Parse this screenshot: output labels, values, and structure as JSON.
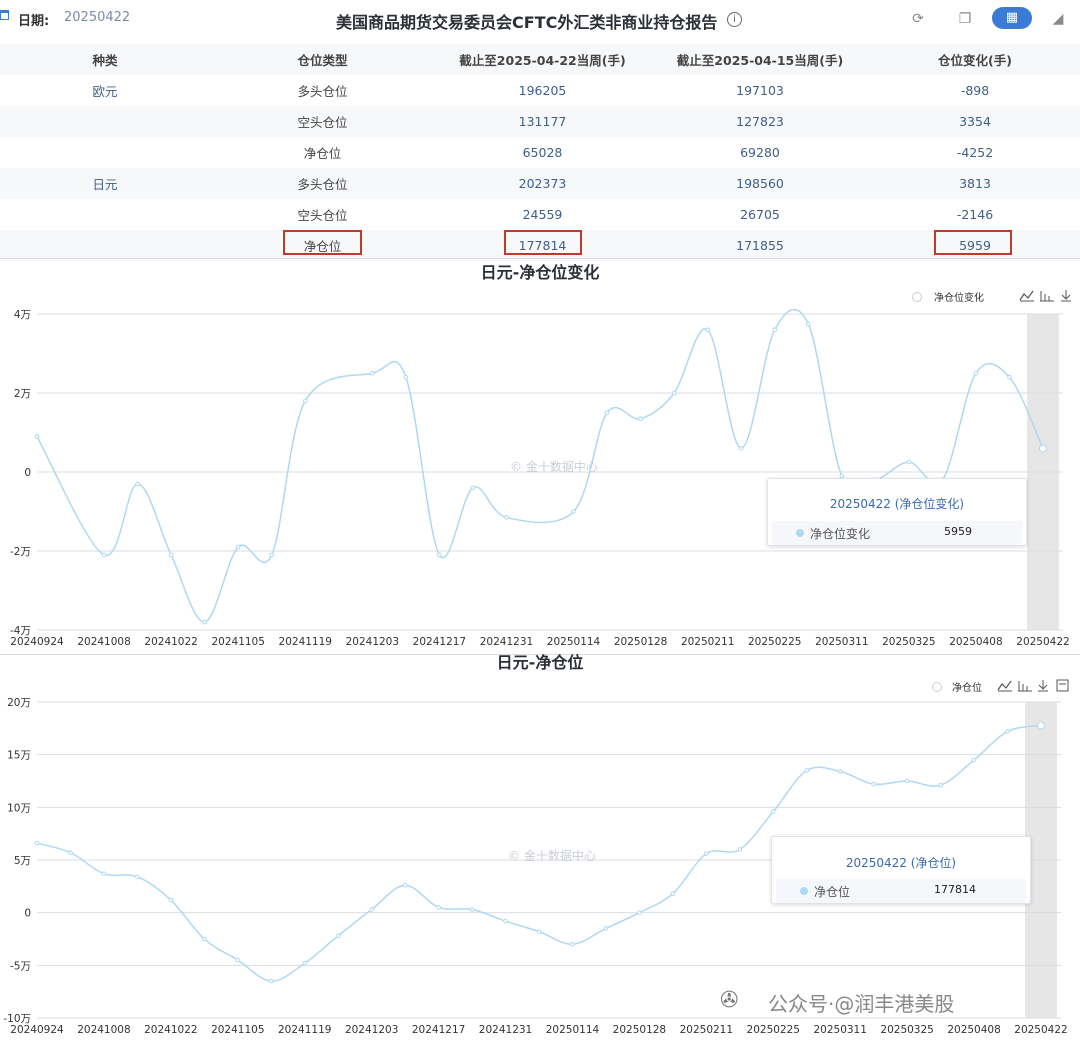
{
  "header": {
    "date_label": "日期:",
    "date_value": "20250422",
    "report_title": "美国商品期货交易委员会CFTC外汇类非商业持仓报告",
    "info_glyph": "i"
  },
  "table": {
    "headers": [
      "种类",
      "仓位类型",
      "截止至2025-04-22当周(手)",
      "截止至2025-04-15当周(手)",
      "仓位变化(手)"
    ],
    "rows": [
      [
        "欧元",
        "多头仓位",
        "196205",
        "197103",
        "-898"
      ],
      [
        "",
        "空头仓位",
        "131177",
        "127823",
        "3354"
      ],
      [
        "",
        "净仓位",
        "65028",
        "69280",
        "-4252"
      ],
      [
        "日元",
        "多头仓位",
        "202373",
        "198560",
        "3813"
      ],
      [
        "",
        "空头仓位",
        "24559",
        "26705",
        "-2146"
      ],
      [
        "",
        "净仓位",
        "177814",
        "171855",
        "5959"
      ]
    ]
  },
  "chart_data": [
    {
      "type": "line",
      "title": "日元-净仓位变化",
      "xlabel": "",
      "ylabel": "",
      "series": [
        {
          "name": "净仓位变化",
          "color": "#aed8f3"
        }
      ],
      "x_ticks": [
        "20240924",
        "20241008",
        "20241022",
        "20241105",
        "20241119",
        "20241203",
        "20241217",
        "20241231",
        "20250114",
        "20250128",
        "20250211",
        "20250225",
        "20250311",
        "20250325",
        "20250408",
        "20250422"
      ],
      "y_ticks": [
        "4万",
        "2万",
        "0",
        "-2万",
        "-4万"
      ],
      "ylim": [
        -40000,
        40000
      ],
      "points": [
        {
          "x": "20240924",
          "y": 9000
        },
        {
          "x": "20241008",
          "y": -21000
        },
        {
          "x": "20241015",
          "y": -3000
        },
        {
          "x": "20241022",
          "y": -21000
        },
        {
          "x": "20241029",
          "y": -38000
        },
        {
          "x": "20241105",
          "y": -19000
        },
        {
          "x": "20241112",
          "y": -21000
        },
        {
          "x": "20241119",
          "y": 18000
        },
        {
          "x": "20241203",
          "y": 25000
        },
        {
          "x": "20241210",
          "y": 24000
        },
        {
          "x": "20241217",
          "y": -21000
        },
        {
          "x": "20241224",
          "y": -4000
        },
        {
          "x": "20241231",
          "y": -11500
        },
        {
          "x": "20250114",
          "y": -10000
        },
        {
          "x": "20250121",
          "y": 15000
        },
        {
          "x": "20250128",
          "y": 13500
        },
        {
          "x": "20250204",
          "y": 20000
        },
        {
          "x": "20250211",
          "y": 36000
        },
        {
          "x": "20250218",
          "y": 6000
        },
        {
          "x": "20250225",
          "y": 36000
        },
        {
          "x": "20250304",
          "y": 37500
        },
        {
          "x": "20250311",
          "y": -1000
        },
        {
          "x": "20250318",
          "y": -2000
        },
        {
          "x": "20250325",
          "y": 2500
        },
        {
          "x": "20250401",
          "y": -2000
        },
        {
          "x": "20250408",
          "y": 25000
        },
        {
          "x": "20250415",
          "y": 24000
        },
        {
          "x": "20250422",
          "y": 5959
        }
      ],
      "tooltip": {
        "title": "20250422 (净仓位变化)",
        "series_name": "净仓位变化",
        "value": "5959"
      },
      "watermark": "© 金十数据中心",
      "legend": {
        "placement": "top-right",
        "label": "净仓位变化"
      },
      "grid": true
    },
    {
      "type": "line",
      "title": "日元-净仓位",
      "xlabel": "",
      "ylabel": "",
      "series": [
        {
          "name": "净仓位",
          "color": "#aed8f3"
        }
      ],
      "x_ticks": [
        "20240924",
        "20241008",
        "20241022",
        "20241105",
        "20241119",
        "20241203",
        "20241217",
        "20241231",
        "20250114",
        "20250128",
        "20250211",
        "20250225",
        "20250311",
        "20250325",
        "20250408",
        "20250422"
      ],
      "y_ticks": [
        "20万",
        "15万",
        "10万",
        "5万",
        "0",
        "-5万",
        "-10万"
      ],
      "ylim": [
        -100000,
        200000
      ],
      "points": [
        {
          "x": "20240924",
          "y": 66000
        },
        {
          "x": "20241001",
          "y": 57000
        },
        {
          "x": "20241008",
          "y": 37000
        },
        {
          "x": "20241015",
          "y": 34000
        },
        {
          "x": "20241022",
          "y": 12000
        },
        {
          "x": "20241029",
          "y": -25000
        },
        {
          "x": "20241105",
          "y": -45000
        },
        {
          "x": "20241112",
          "y": -65000
        },
        {
          "x": "20241119",
          "y": -48000
        },
        {
          "x": "20241126",
          "y": -22000
        },
        {
          "x": "20241203",
          "y": 3000
        },
        {
          "x": "20241210",
          "y": 26000
        },
        {
          "x": "20241217",
          "y": 5000
        },
        {
          "x": "20241224",
          "y": 3000
        },
        {
          "x": "20241231",
          "y": -8000
        },
        {
          "x": "20250107",
          "y": -18000
        },
        {
          "x": "20250114",
          "y": -30000
        },
        {
          "x": "20250121",
          "y": -15000
        },
        {
          "x": "20250128",
          "y": 0
        },
        {
          "x": "20250204",
          "y": 18000
        },
        {
          "x": "20250211",
          "y": 56000
        },
        {
          "x": "20250218",
          "y": 60000
        },
        {
          "x": "20250225",
          "y": 96000
        },
        {
          "x": "20250304",
          "y": 135000
        },
        {
          "x": "20250311",
          "y": 134000
        },
        {
          "x": "20250318",
          "y": 122000
        },
        {
          "x": "20250325",
          "y": 125000
        },
        {
          "x": "20250401",
          "y": 121000
        },
        {
          "x": "20250408",
          "y": 145000
        },
        {
          "x": "20250415",
          "y": 172000
        },
        {
          "x": "20250422",
          "y": 177814
        }
      ],
      "tooltip": {
        "title": "20250422 (净仓位)",
        "series_name": "净仓位",
        "value": "177814"
      },
      "watermark": "© 金十数据中心",
      "legend": {
        "placement": "top-right",
        "label": "净仓位"
      },
      "grid": true
    }
  ],
  "watermark_footer": {
    "icon": "wechat-icon",
    "text": "公众号·@润丰港美股"
  },
  "colors": {
    "accent": "#3a7bd5",
    "highlight": "#c0392b",
    "line": "#aed8f3",
    "grid": "#d9dde3"
  }
}
